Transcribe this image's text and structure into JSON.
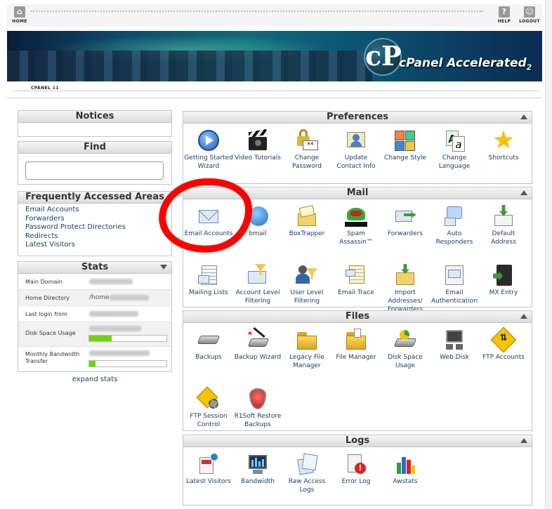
{
  "topnav": {
    "home": "HOME",
    "help": "HELP",
    "logout": "LOGOUT"
  },
  "banner": {
    "logo_text": "cPanel Accelerated",
    "logo_sub": "2",
    "logo_mark": "cP"
  },
  "subbar": {
    "version": "CPANEL 11"
  },
  "sidebar": {
    "notices_title": "Notices",
    "find_title": "Find",
    "faa_title": "Frequently Accessed Areas",
    "faa_links": [
      "Email Accounts",
      "Forwarders",
      "Password Protect Directories",
      "Redirects",
      "Latest Visitors"
    ],
    "stats_title": "Stats",
    "stats": {
      "main_domain": "Main Domain",
      "home_dir": "Home Directory",
      "home_dir_value": "/home",
      "last_login": "Last login from",
      "disk_usage": "Disk Space Usage",
      "disk_usage_pct": 0.29,
      "bandwidth": "Monthly Bandwidth Transfer",
      "bandwidth_pct": 0.08
    },
    "expand_stats": "expand stats"
  },
  "sections": {
    "preferences": {
      "title": "Preferences",
      "items": [
        "Getting Started Wizard",
        "Video Tutorials",
        "Change Password",
        "Update Contact Info",
        "Change Style",
        "Change Language",
        "Shortcuts"
      ]
    },
    "mail": {
      "title": "Mail",
      "row1": [
        "Email Accounts",
        "Webmail",
        "BoxTrapper",
        "Spam Assassin™",
        "Forwarders",
        "Auto Responders",
        "Default Address"
      ],
      "row2": [
        "Mailing Lists",
        "Account Level Filtering",
        "User Level Filtering",
        "Email Trace",
        "Import Addresses/ Forwarders",
        "Email Authentication",
        "MX Entry"
      ],
      "webmail_visible": "bmail"
    },
    "files": {
      "title": "Files",
      "row1": [
        "Backups",
        "Backup Wizard",
        "Legacy File Manager",
        "File Manager",
        "Disk Space Usage",
        "Web Disk",
        "FTP Accounts"
      ],
      "row2": [
        "FTP Session Control",
        "R1Soft Restore Backups"
      ]
    },
    "logs": {
      "title": "Logs",
      "items": [
        "Latest Visitors",
        "Bandwidth",
        "Raw Access Logs",
        "Error Log",
        "Awstats"
      ]
    }
  },
  "colors": {
    "link": "#1a3f6b",
    "annotation": "#ff0000",
    "progress": "#6bd600"
  }
}
